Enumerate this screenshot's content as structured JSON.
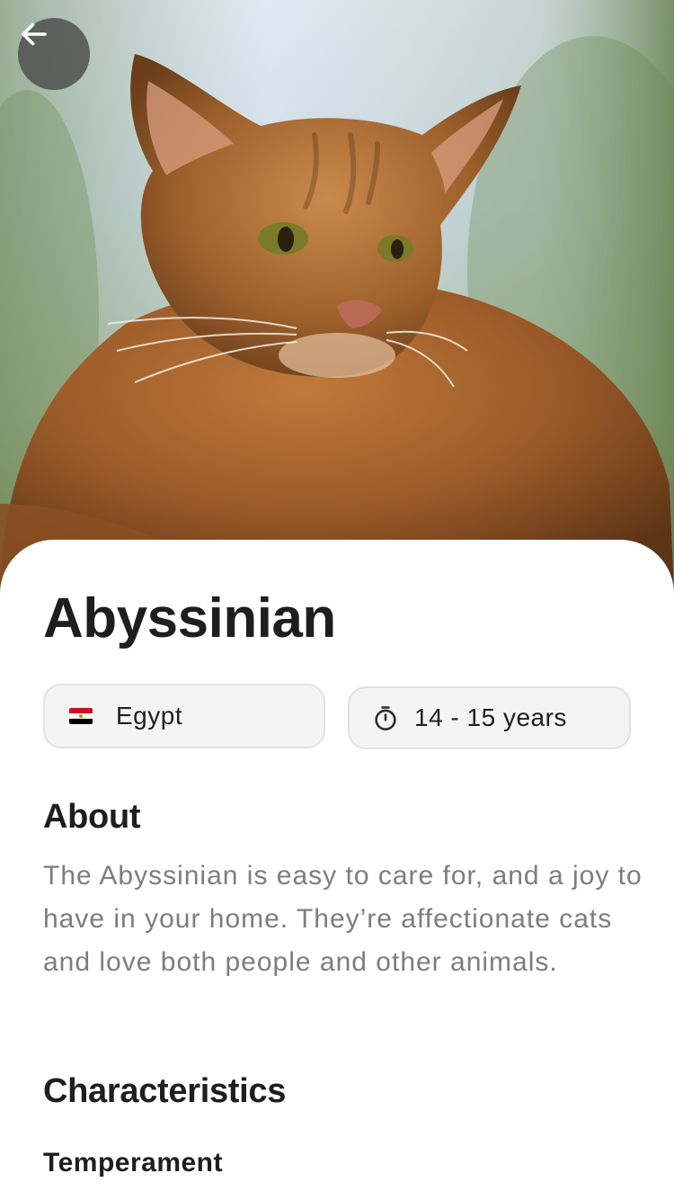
{
  "header": {
    "back_icon": "arrow-left-icon",
    "hero_image": "abyssinian-cat-photo"
  },
  "breed": {
    "name": "Abyssinian",
    "origin": "Egypt",
    "origin_flag_icon": "egypt-flag-icon",
    "life_span": "14 - 15 years",
    "life_span_icon": "stopwatch-icon"
  },
  "about": {
    "heading": "About",
    "text": "The Abyssinian is easy to care for, and a joy to have in your home. They’re affectionate cats and love both people and other animals."
  },
  "characteristics": {
    "heading": "Characteristics",
    "temperament_label": "Temperament"
  },
  "colors": {
    "text_primary": "#1e1e1e",
    "text_secondary": "#7d7d7d",
    "chip_background": "#f4f4f4",
    "chip_border": "#e2e2e2",
    "back_button": "#464646"
  }
}
